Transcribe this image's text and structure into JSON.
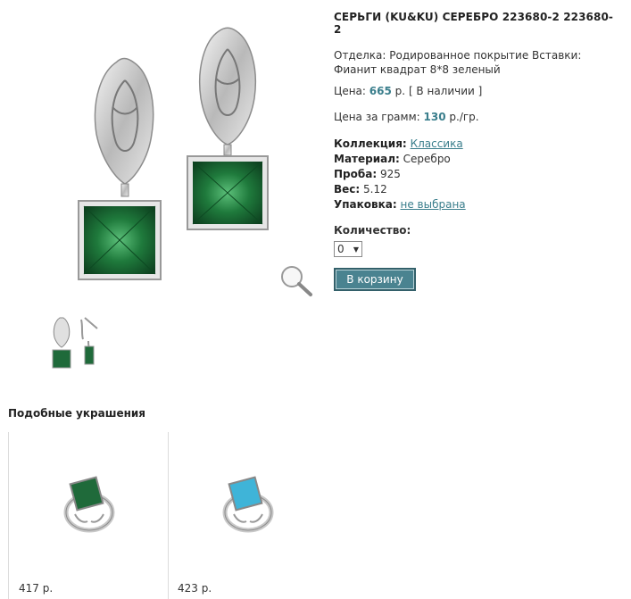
{
  "product": {
    "title": "СЕРЬГИ (KU&KU) СЕРЕБРО 223680-2 223680-2",
    "description": "Отделка: Родированное покрытие Вставки: Фианит квадрат 8*8 зеленый",
    "price_label": "Цена:",
    "price_value": "665",
    "price_unit": "р.",
    "availability": "[ В наличии ]",
    "gram_price_label": "Цена за грамм:",
    "gram_price_value": "130",
    "gram_price_unit": "р./гр.",
    "attributes": {
      "collection_label": "Коллекция:",
      "collection_value": "Классика",
      "material_label": "Материал:",
      "material_value": "Серебро",
      "probe_label": "Проба:",
      "probe_value": "925",
      "weight_label": "Вес:",
      "weight_value": "5.12",
      "package_label": "Упаковка:",
      "package_value": "не выбрана"
    },
    "quantity_label": "Количество:",
    "quantity_value": "0",
    "cart_button": "В корзину"
  },
  "similar": {
    "title": "Подобные украшения",
    "items": [
      {
        "price": "417 р.",
        "stone_color": "#1f6a3a"
      },
      {
        "price": "423 р.",
        "stone_color": "#3fb4d8"
      }
    ]
  },
  "colors": {
    "accent": "#3a7e8c",
    "button_bg": "#4a8390",
    "emerald": "#1f6a3a"
  }
}
